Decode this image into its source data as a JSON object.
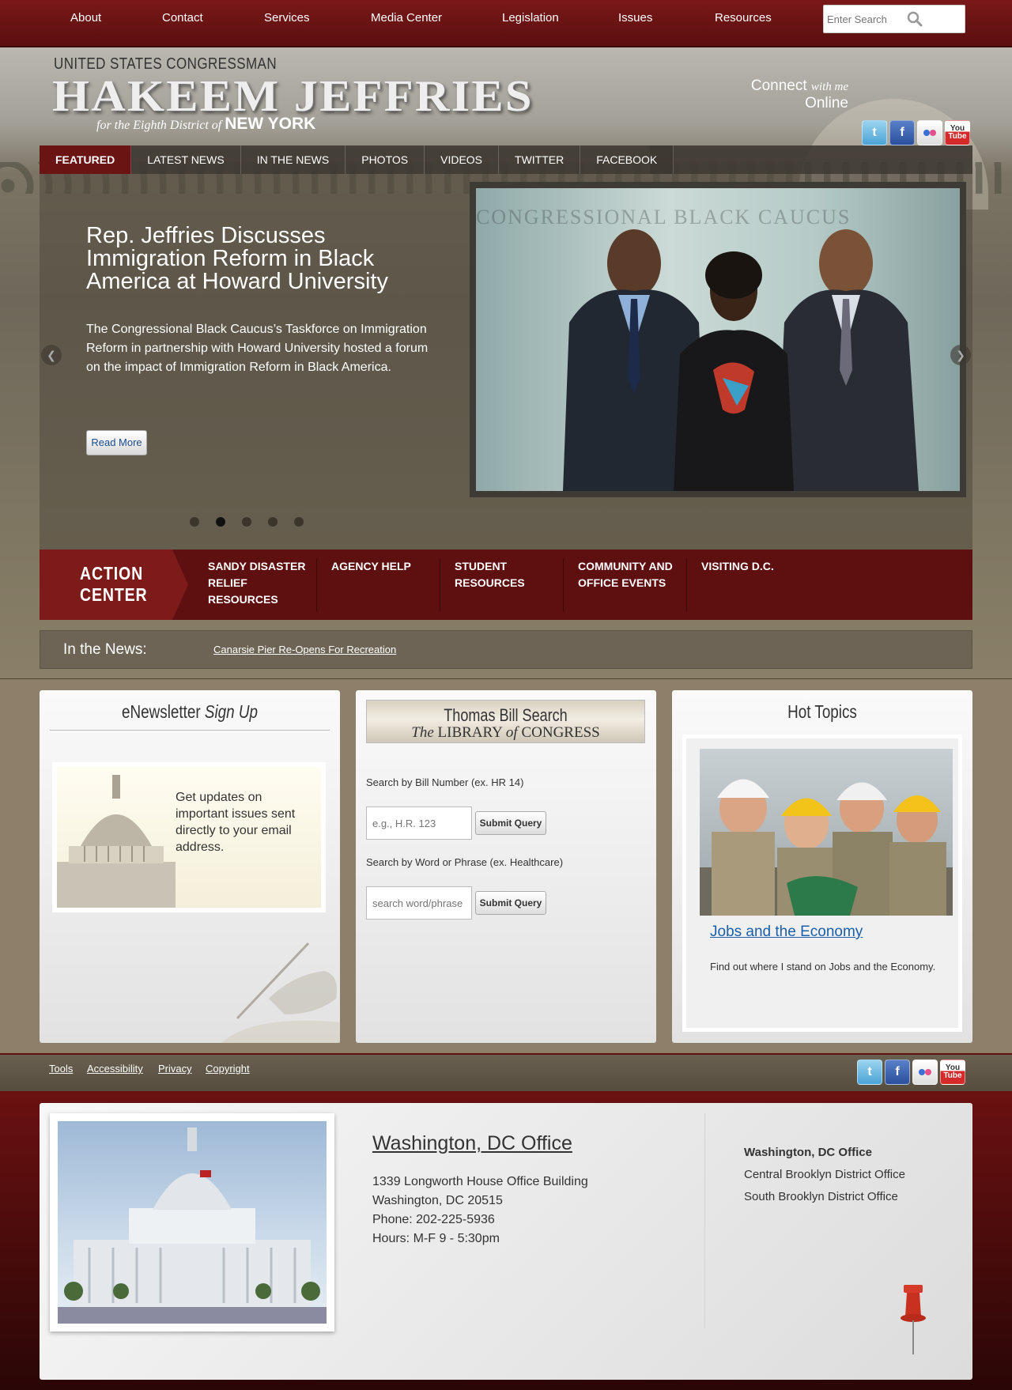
{
  "topnav": {
    "items": [
      "About",
      "Contact",
      "Services",
      "Media Center",
      "Legislation",
      "Issues",
      "Resources"
    ],
    "search_placeholder": "Enter Search"
  },
  "header": {
    "line1": "UNITED STATES CONGRESSMAN",
    "name": "HAKEEM JEFFRIES",
    "sub_prefix": "for the Eighth District of",
    "sub_state": "NEW YORK",
    "connect_a": "Connect",
    "connect_b": "with me",
    "connect_c": "Online",
    "social_icons": [
      "twitter-icon",
      "facebook-icon",
      "flickr-icon",
      "youtube-icon"
    ]
  },
  "tabs": [
    "FEATURED",
    "LATEST NEWS",
    "IN THE NEWS",
    "PHOTOS",
    "VIDEOS",
    "TWITTER",
    "FACEBOOK"
  ],
  "slide": {
    "title": "Rep. Jeffries Discusses Immigration Reform in Black America at Howard University",
    "body": "The Congressional Black Caucus’s Taskforce on Immigration Reform in partnership with Howard University hosted a forum on the impact of Immigration Reform in Black America.",
    "read_more": "Read More",
    "photo_banner": "CONGRESSIONAL BLACK CAUCUS",
    "active_dot": 2,
    "dot_count": 5
  },
  "action_center": {
    "label_1": "ACTION",
    "label_2": "CENTER",
    "links": [
      "SANDY DISASTER RELIEF RESOURCES",
      "AGENCY HELP",
      "STUDENT RESOURCES",
      "COMMUNITY AND OFFICE EVENTS",
      "VISITING D.C."
    ]
  },
  "in_the_news": {
    "label": "In the News:",
    "headline": "Canarsie Pier Re-Opens For Recreation"
  },
  "newsletter": {
    "title_a": "eNewsletter",
    "title_b": "Sign Up",
    "image_text": "Get updates on important issues sent directly to your email address."
  },
  "thomas": {
    "title": "Thomas Bill Search",
    "subtitle_the": "The",
    "subtitle_lib": "LIBRARY",
    "subtitle_of": "of",
    "subtitle_cong": "CONGRESS",
    "bill_label": "Search by Bill Number (ex. HR 14)",
    "bill_placeholder": "e.g., H.R. 123",
    "word_label": "Search by Word or Phrase (ex. Healthcare)",
    "word_placeholder": "search word/phrase",
    "submit": "Submit Query"
  },
  "hot_topics": {
    "title": "Hot Topics",
    "link": "Jobs and the Economy",
    "desc": "Find out where I stand on Jobs and the Economy."
  },
  "util_links": [
    "Tools",
    "Accessibility",
    "Privacy",
    "Copyright"
  ],
  "office": {
    "title": "Washington, DC Office",
    "address": [
      "1339 Longworth House Office Building",
      "Washington, DC 20515",
      "Phone: 202-225-5936",
      "Hours: M-F 9 - 5:30pm"
    ],
    "list": [
      "Washington, DC Office",
      "Central Brooklyn District Office",
      "South Brooklyn District Office"
    ]
  },
  "colors": {
    "brand_red": "#6b1414",
    "link_blue": "#1a5fa8",
    "khaki": "#8d7f6a"
  }
}
